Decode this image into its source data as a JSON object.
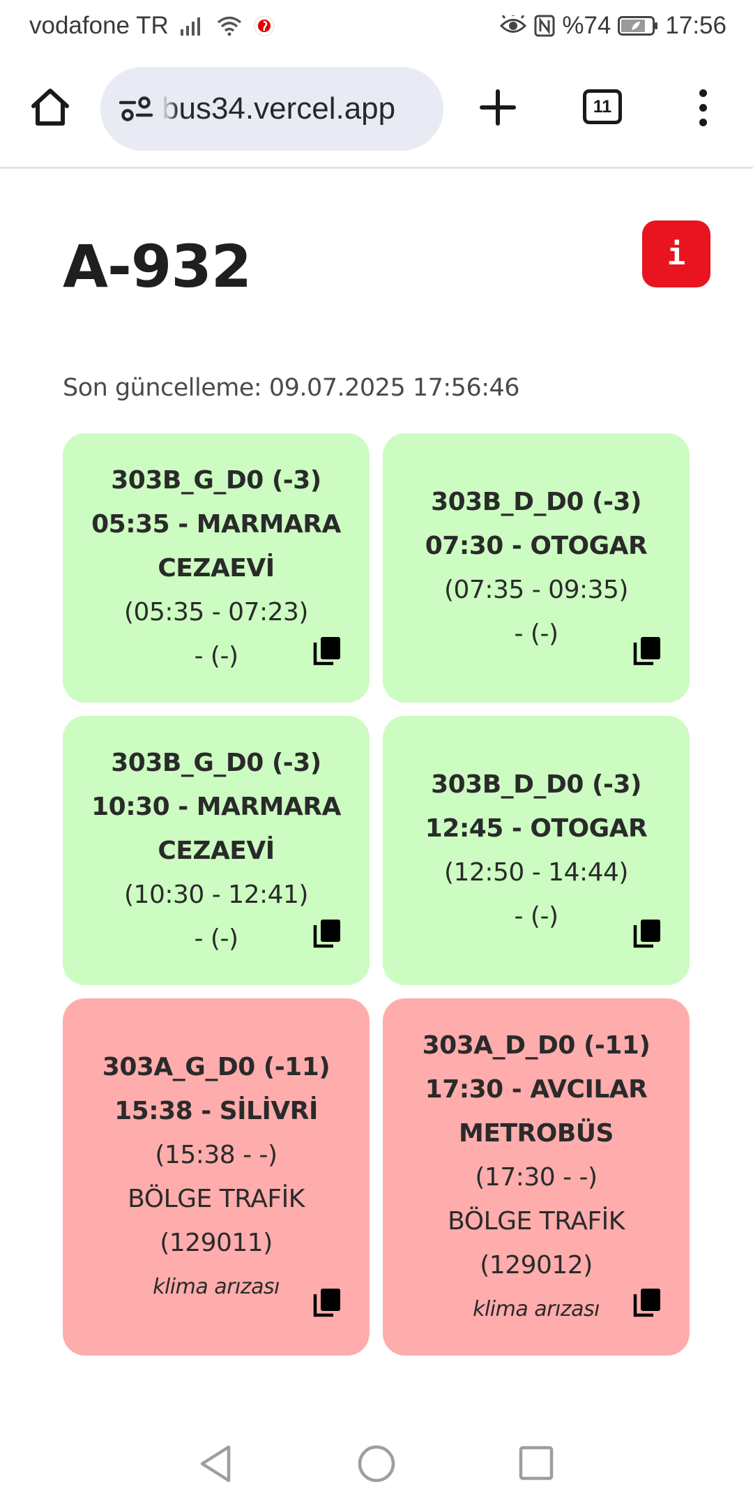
{
  "status_bar": {
    "carrier": "vodafone TR",
    "battery_percent": "%74",
    "time": "17:56",
    "icons": [
      "signal-icon",
      "wifi-icon",
      "vodafone-icon",
      "eye-comfort-icon",
      "nfc-icon",
      "battery-icon"
    ]
  },
  "browser": {
    "url": "bus34.vercel.app",
    "tab_count": "11",
    "icons": [
      "home-icon",
      "site-settings-icon",
      "plus-icon",
      "tabs-icon",
      "more-vert-icon"
    ]
  },
  "page": {
    "title": "A-932",
    "info_label": "i",
    "last_update": "Son güncelleme: 09.07.2025 17:56:46"
  },
  "colors": {
    "ok_card": "#ccfcc1",
    "bad_card": "#ffacac",
    "info_button": "#e8141f"
  },
  "trips": [
    {
      "status": "ok",
      "line_code": "303B_G_D0 (-3)",
      "departure_lines": [
        "05:35 - MARMARA",
        "CEZAEVİ"
      ],
      "time_range": "(05:35 - 07:23)",
      "detail": "- (-)"
    },
    {
      "status": "ok",
      "line_code": "303B_D_D0 (-3)",
      "departure_lines": [
        "07:30 - OTOGAR"
      ],
      "time_range": "(07:35 - 09:35)",
      "detail": "- (-)"
    },
    {
      "status": "ok",
      "line_code": "303B_G_D0 (-3)",
      "departure_lines": [
        "10:30 - MARMARA",
        "CEZAEVİ"
      ],
      "time_range": "(10:30 - 12:41)",
      "detail": "- (-)"
    },
    {
      "status": "ok",
      "line_code": "303B_D_D0 (-3)",
      "departure_lines": [
        "12:45 - OTOGAR"
      ],
      "time_range": "(12:50 - 14:44)",
      "detail": "- (-)"
    },
    {
      "status": "bad",
      "line_code": "303A_G_D0 (-11)",
      "departure_lines": [
        "15:38 - SİLİVRİ"
      ],
      "time_range": "(15:38 - -)",
      "region": "BÖLGE TRAFİK",
      "code": "(129011)",
      "note": "klima arızası"
    },
    {
      "status": "bad",
      "line_code": "303A_D_D0 (-11)",
      "departure_lines": [
        "17:30 - AVCILAR",
        "METROBÜS"
      ],
      "time_range": "(17:30 - -)",
      "region": "BÖLGE TRAFİK",
      "code": "(129012)",
      "note": "klima arızası"
    }
  ],
  "nav_bar": {
    "icons": [
      "back-icon",
      "home-circle-icon",
      "recents-icon"
    ]
  }
}
